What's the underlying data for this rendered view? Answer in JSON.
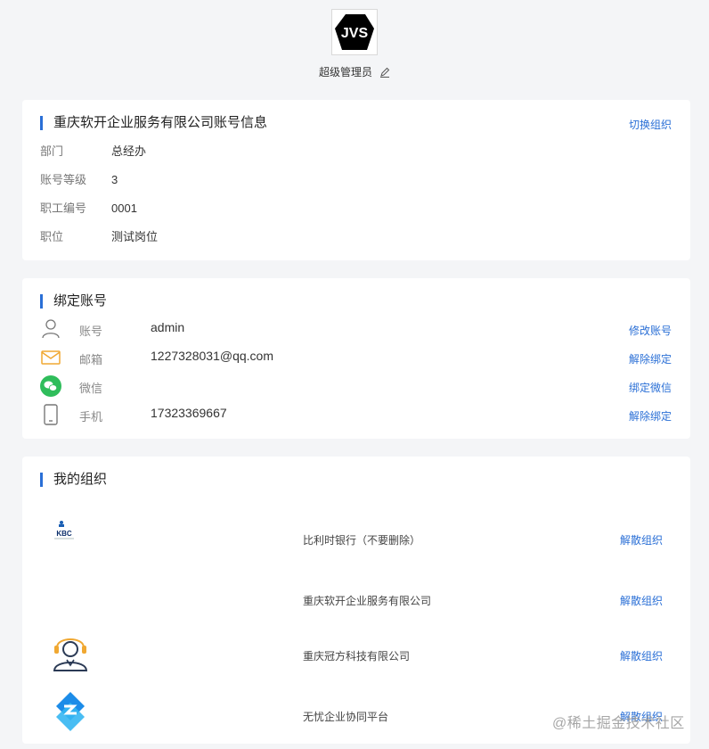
{
  "profile": {
    "avatar_text": "JVS",
    "name": "超级管理员"
  },
  "account_info": {
    "title": "重庆软开企业服务有限公司账号信息",
    "switch_label": "切换组织",
    "fields": [
      {
        "label": "部门",
        "value": "总经办"
      },
      {
        "label": "账号等级",
        "value": "3"
      },
      {
        "label": "职工编号",
        "value": "0001"
      },
      {
        "label": "职位",
        "value": "测试岗位"
      }
    ]
  },
  "bindings": {
    "title": "绑定账号",
    "rows": [
      {
        "icon": "user-icon",
        "label": "账号",
        "value": "admin",
        "action": "修改账号"
      },
      {
        "icon": "mail-icon",
        "label": "邮箱",
        "value": "1227328031@qq.com",
        "action": "解除绑定"
      },
      {
        "icon": "wechat-icon",
        "label": "微信",
        "value": "",
        "action": "绑定微信"
      },
      {
        "icon": "phone-icon",
        "label": "手机",
        "value": "17323369667",
        "action": "解除绑定"
      }
    ]
  },
  "orgs": {
    "title": "我的组织",
    "items": [
      {
        "logo": "kbc-logo",
        "name": "比利时银行（不要删除）",
        "action": "解散组织"
      },
      {
        "logo": "",
        "name": "重庆软开企业服务有限公司",
        "action": "解散组织"
      },
      {
        "logo": "support-agent-logo",
        "name": "重庆冠方科技有限公司",
        "action": "解散组织"
      },
      {
        "logo": "wuyou-logo",
        "name": "无忧企业协同平台",
        "action": "解散组织"
      }
    ]
  },
  "watermark": "@稀土掘金技术社区",
  "colors": {
    "accent": "#2a6fd6",
    "background": "#f4f5f7"
  }
}
